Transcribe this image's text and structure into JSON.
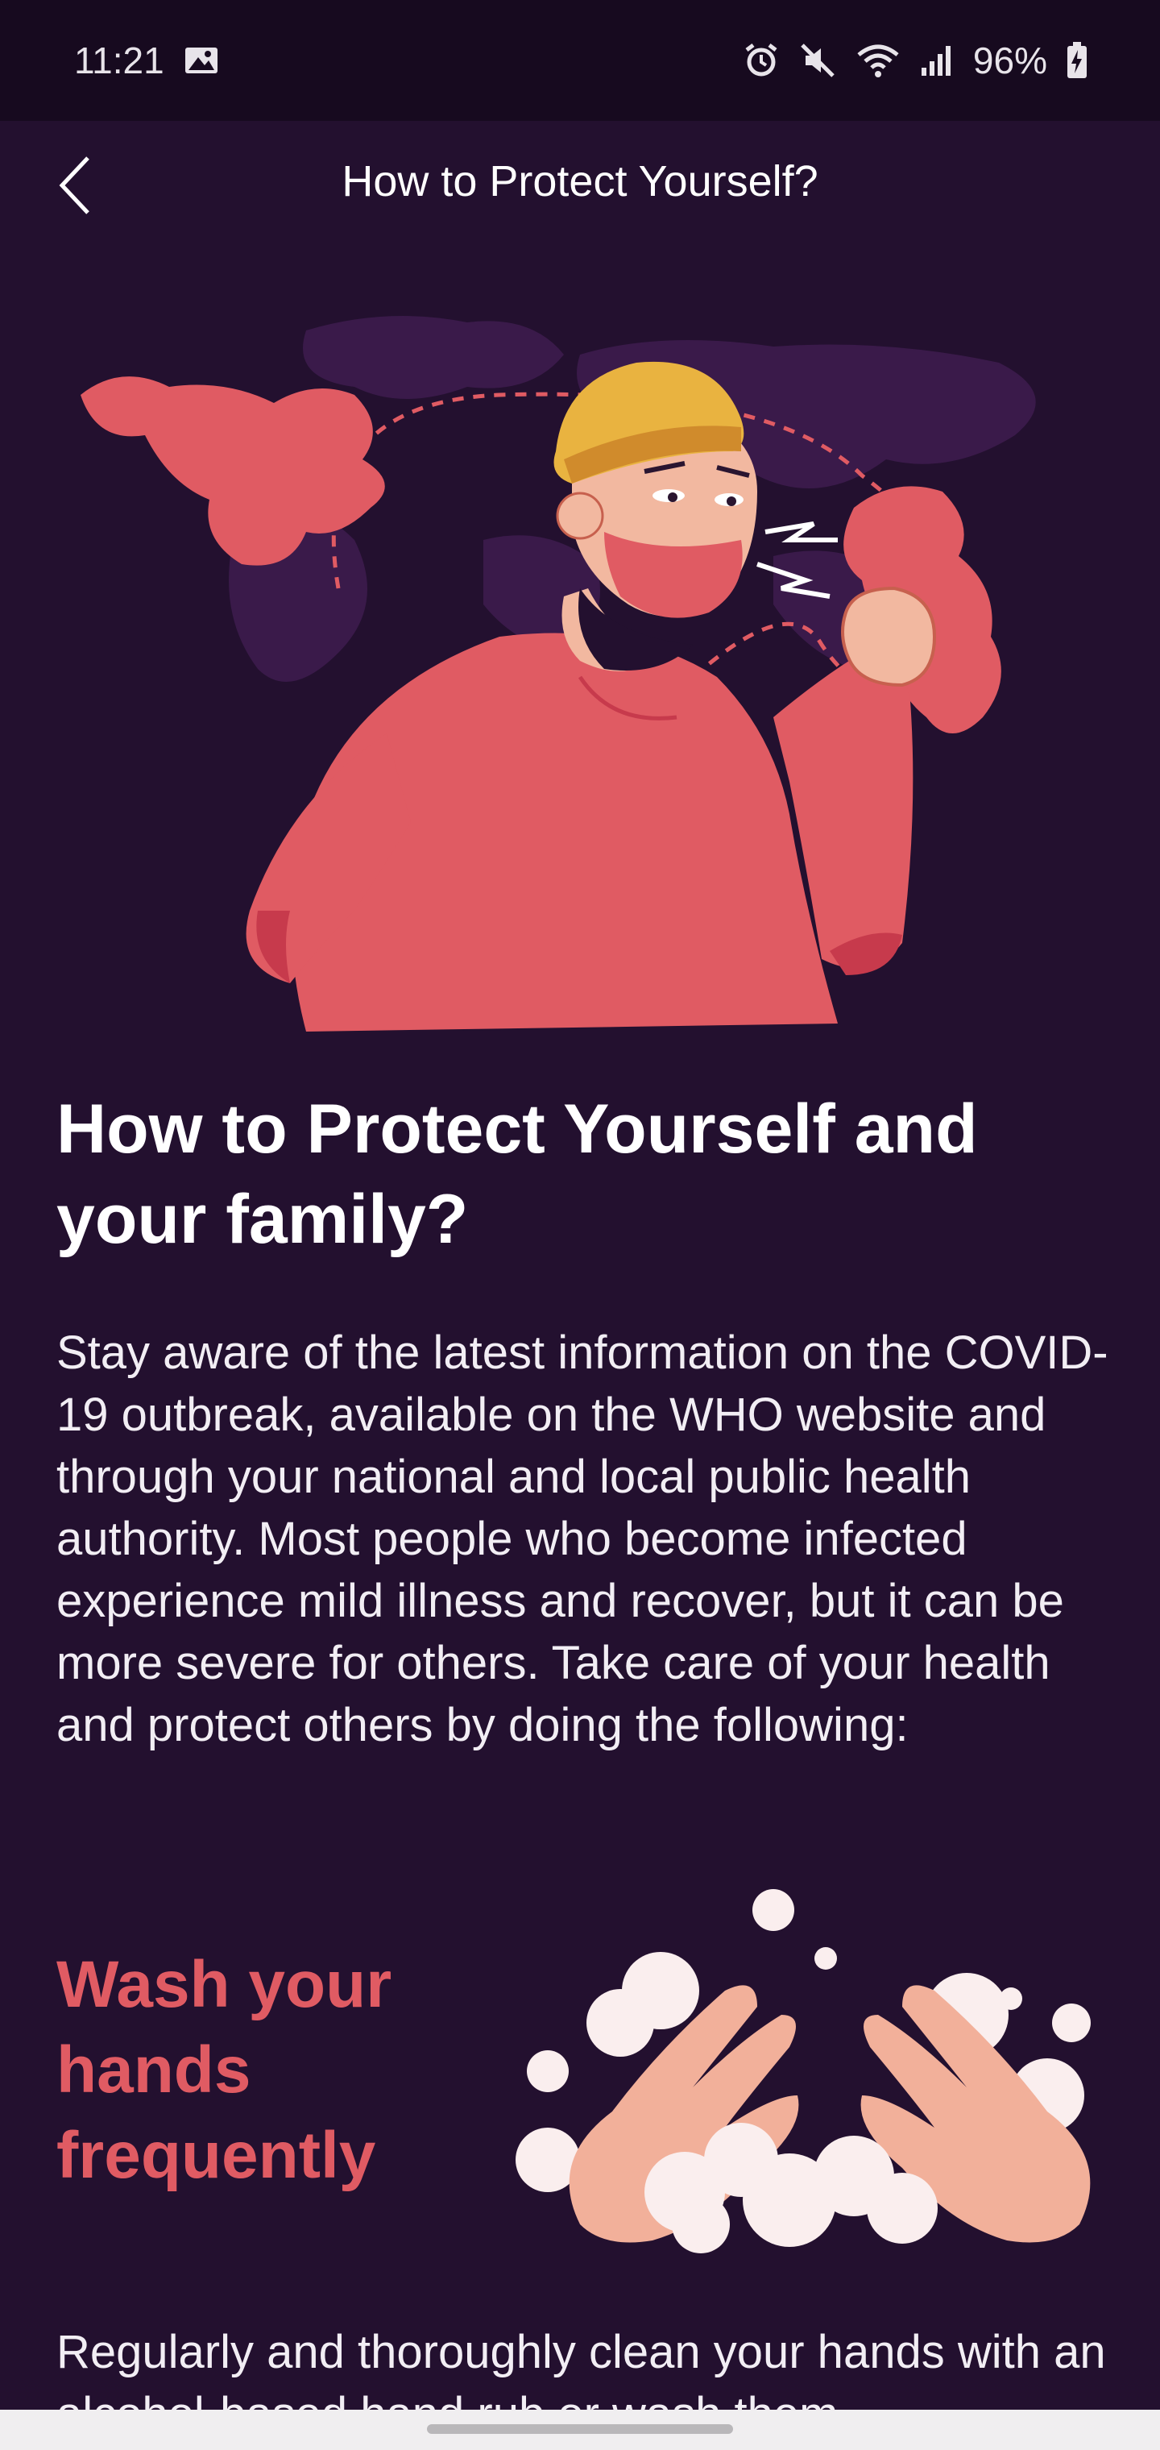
{
  "status_bar": {
    "time": "11:21",
    "battery": "96%",
    "icons": [
      "image-icon",
      "alarm-icon",
      "mute-icon",
      "wifi-icon",
      "signal-icon",
      "battery-charging-icon"
    ]
  },
  "header": {
    "title": "How to Protect Yourself?",
    "back_icon": "chevron-left-icon"
  },
  "hero": {
    "illustration": "man-in-mask-coughing-into-elbow-over-world-map"
  },
  "content": {
    "heading": "How to Protect Yourself and your family?",
    "intro": "Stay aware of the latest information on the COVID-19 outbreak, available on the WHO website and through your national and local public health authority. Most people who become infected experience mild illness and recover, but it can be more severe for others. Take care of your health and protect others by doing the following:",
    "tips": [
      {
        "title": "Wash your hands frequently",
        "illustration": "soapy-hands",
        "text": "Regularly and thoroughly clean your hands with an alcohol-based hand rub or wash them"
      }
    ]
  },
  "colors": {
    "background": "#23102f",
    "status_bar": "#170a1f",
    "accent": "#e05b63",
    "text": "#ffffff"
  }
}
